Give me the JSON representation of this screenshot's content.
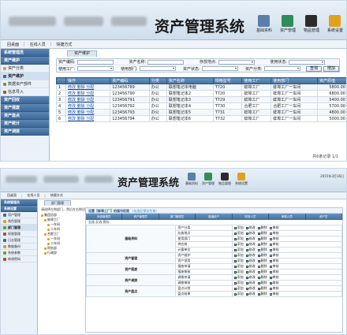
{
  "colors": {
    "accent": "#3c6898",
    "header_bg": "#dbe7f2",
    "link": "#1a4fa0"
  },
  "screen1": {
    "app_title": "资产管理系统",
    "header_buttons": [
      {
        "label": "基础资料",
        "icon": "document-icon",
        "color": "#5a7ea6"
      },
      {
        "label": "资产管理",
        "icon": "books-icon",
        "color": "#2f8d5a"
      },
      {
        "label": "物品管理",
        "icon": "box-icon",
        "color": "#2b2b2b"
      },
      {
        "label": "系统设置",
        "icon": "gear-icon",
        "color": "#e0a21b"
      }
    ],
    "quickbar": {
      "home": "回桌面",
      "online": "在线人员",
      "shortcut": "快捷方式"
    },
    "sidebar": {
      "group_main": "系统管理员",
      "group_sub": "资产维护",
      "items": [
        {
          "label": "资产分类",
          "icon": "folder-icon"
        },
        {
          "label": "资产维护",
          "icon": "edit-icon"
        },
        {
          "label": "数据资产部件",
          "icon": "parts-icon"
        },
        {
          "label": "信息导入",
          "icon": "import-icon"
        }
      ],
      "groups_bottom": [
        "资产回收",
        "资产报废",
        "资产盘点",
        "资产统计",
        "资产调拨"
      ]
    },
    "tab": "资产维护",
    "form": {
      "row1": [
        "资产编码:",
        "资产名称:",
        "存放地点:",
        "使用状态:"
      ],
      "row2": [
        "使用工厂:",
        "使用部门:",
        "资产状态:",
        "资产分类:"
      ],
      "query_btn": "查询",
      "add_btn": "增加"
    },
    "table": {
      "headers": [
        "",
        "操作",
        "资产编码",
        "分类",
        "资产名称",
        "规格型号",
        "使用工厂",
        "使用部门",
        "资产原值"
      ],
      "rows": [
        [
          "1",
          "修改 删除 分配",
          "123456789",
          "办公",
          "联想笔记本电脑",
          "T720",
          "蚌埠工厂",
          "蚌埠工厂一车间",
          "5800.00"
        ],
        [
          "2",
          "修改 删除 分配",
          "123456790",
          "办公",
          "联想笔记本2",
          "T720",
          "蚌埠工厂",
          "蚌埠工厂一车间",
          "6800.00"
        ],
        [
          "3",
          "修改 删除 分配",
          "123456791",
          "办公",
          "联想笔记本3",
          "T729",
          "蚌埠工厂",
          "蚌埠工厂一车间",
          "5400.00"
        ],
        [
          "4",
          "修改 删除 分配",
          "123456792",
          "办公",
          "联想笔记本4",
          "T730",
          "合肥工厂",
          "合肥工厂一车间",
          "5700.00"
        ],
        [
          "5",
          "修改 删除 分配",
          "123456793",
          "办公",
          "联想笔记本5",
          "T731",
          "蚌埠工厂",
          "蚌埠工厂一车间",
          "4800.00"
        ],
        [
          "6",
          "修改 删除 分配",
          "123456794",
          "办公",
          "联想笔记本6",
          "T732",
          "蚌埠工厂",
          "蚌埠工厂一车间",
          "5000.00"
        ]
      ]
    },
    "pager": "共6条记录 1/1"
  },
  "screen2": {
    "app_title": "资产管理系统",
    "date": "2015年3月16日",
    "header_buttons": [
      {
        "label": "基础资料",
        "icon": "document-icon",
        "color": "#5a7ea6"
      },
      {
        "label": "资产管理",
        "icon": "books-icon",
        "color": "#2f8d5a"
      },
      {
        "label": "物品管理",
        "icon": "box-icon",
        "color": "#2b2b2b"
      },
      {
        "label": "系统设置",
        "icon": "gear-icon",
        "color": "#e0a21b"
      }
    ],
    "quickbar": {
      "home": "回桌面",
      "online": "在线人员",
      "shortcut": "快捷方式"
    },
    "sidebar": {
      "group_main": "系统管理员",
      "group_sub": "系统设置",
      "items": [
        {
          "label": "用户管理",
          "icon": "user-icon"
        },
        {
          "label": "角色管理",
          "icon": "role-icon"
        },
        {
          "label": "部门管理",
          "icon": "dept-icon"
        },
        {
          "label": "权限管理",
          "icon": "key-icon"
        },
        {
          "label": "日志管理",
          "icon": "log-icon"
        },
        {
          "label": "数据备份",
          "icon": "backup-icon"
        },
        {
          "label": "系统参数",
          "icon": "param-icon"
        },
        {
          "label": "修改密码",
          "icon": "lock-icon"
        }
      ]
    },
    "tab": "部门管理",
    "note": "请选择左侧部门，然后在右侧设置权限",
    "tree": [
      {
        "label": "集团总部",
        "level": 0
      },
      {
        "label": "蚌埠工厂",
        "level": 1
      },
      {
        "label": "一车间",
        "level": 2
      },
      {
        "label": "二车间",
        "level": 2
      },
      {
        "label": "合肥工厂",
        "level": 1
      },
      {
        "label": "一车间",
        "level": 2
      },
      {
        "label": "二车间",
        "level": 2
      },
      {
        "label": "财务部",
        "level": 1
      },
      {
        "label": "行政部",
        "level": 1
      }
    ],
    "perm": {
      "title": "设置【蚌埠工厂】的操作权限",
      "hint": "（勾选后保存生效）",
      "roles": [
        "系统管理员",
        "资产管理员",
        "部门管理员",
        "普通用户",
        "财务人员",
        "审核人员",
        "资产员"
      ],
      "actions": "全选 反选 保存",
      "ops": [
        "添加",
        "修改",
        "删除",
        "审核"
      ],
      "categories": [
        {
          "name": "基础资料",
          "modules": [
            "资产分类",
            "存放地点",
            "使用部门",
            "供应商",
            "计量单位"
          ]
        },
        {
          "name": "资产管理",
          "modules": [
            "资产维护",
            "资产领用"
          ]
        },
        {
          "name": "资产报废",
          "modules": [
            "报废申请",
            "报废审核"
          ]
        },
        {
          "name": "资产调拨",
          "modules": [
            "调拨申请",
            "调拨审核"
          ]
        },
        {
          "name": "资产盘点",
          "modules": [
            "盘点计划",
            "盘点结果"
          ]
        }
      ]
    }
  }
}
